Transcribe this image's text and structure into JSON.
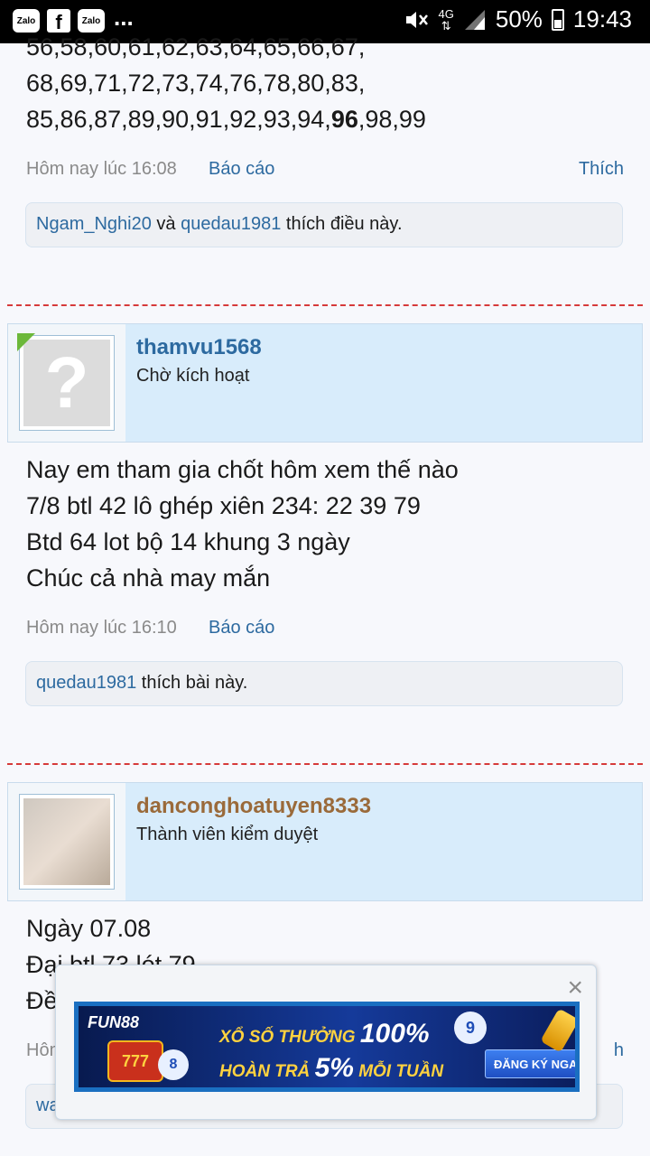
{
  "statusbar": {
    "apps": [
      "Zalo",
      "f",
      "Zalo"
    ],
    "more": "...",
    "network": "4G",
    "battery": "50%",
    "time": "19:43"
  },
  "post1": {
    "lines": [
      "56,58,60,61,62,63,64,65,66,67,",
      "68,69,71,72,73,74,76,78,80,83,"
    ],
    "line3_a": "85,86,87,89,90,91,92,93,94,",
    "line3_bold": "96",
    "line3_b": ",98,99",
    "time": "Hôm nay lúc 16:08",
    "report": "Báo cáo",
    "like": "Thích",
    "likes_user1": "Ngam_Nghi20",
    "likes_and": " và ",
    "likes_user2": "quedau1981",
    "likes_suffix": " thích điều này."
  },
  "post2": {
    "username": "thamvu1568",
    "usertitle": "Chờ kích hoạt",
    "lines": [
      "Nay em tham gia chốt hôm xem thế nào",
      "7/8 btl 42 lô ghép xiên 234: 22 39 79",
      "Btd 64 lot bộ 14 khung 3 ngày",
      "Chúc cả nhà may mắn"
    ],
    "time": "Hôm nay lúc 16:10",
    "report": "Báo cáo",
    "likes_user": "quedau1981",
    "likes_suffix": " thích bài này."
  },
  "post3": {
    "username": "dancongh oatuyen8333",
    "usertitle": "Thành viên kiểm duyệt",
    "lines": [
      "Ngày 07.08",
      "Đại btl 73 lót 79",
      "Đề"
    ],
    "time_partial": "Hôm",
    "like_partial": "h",
    "likes_partial": "wa"
  },
  "ad": {
    "close": "×",
    "brand": "FUN88",
    "line1_a": "XỔ SỐ THƯỞNG ",
    "line1_b": "100%",
    "line2_a": "HOÀN TRẢ ",
    "line2_b": "5%",
    "line2_c": " MỖI TUẦN",
    "cta": "ĐĂNG KÝ NGAY",
    "slot": "777",
    "ball_a": "8",
    "ball_b": "9"
  },
  "colors": {
    "link": "#2d6aa0",
    "username_post3": "#9a6a3a",
    "divider": "#d63a3a",
    "author_bg": "#d8ecfb"
  }
}
